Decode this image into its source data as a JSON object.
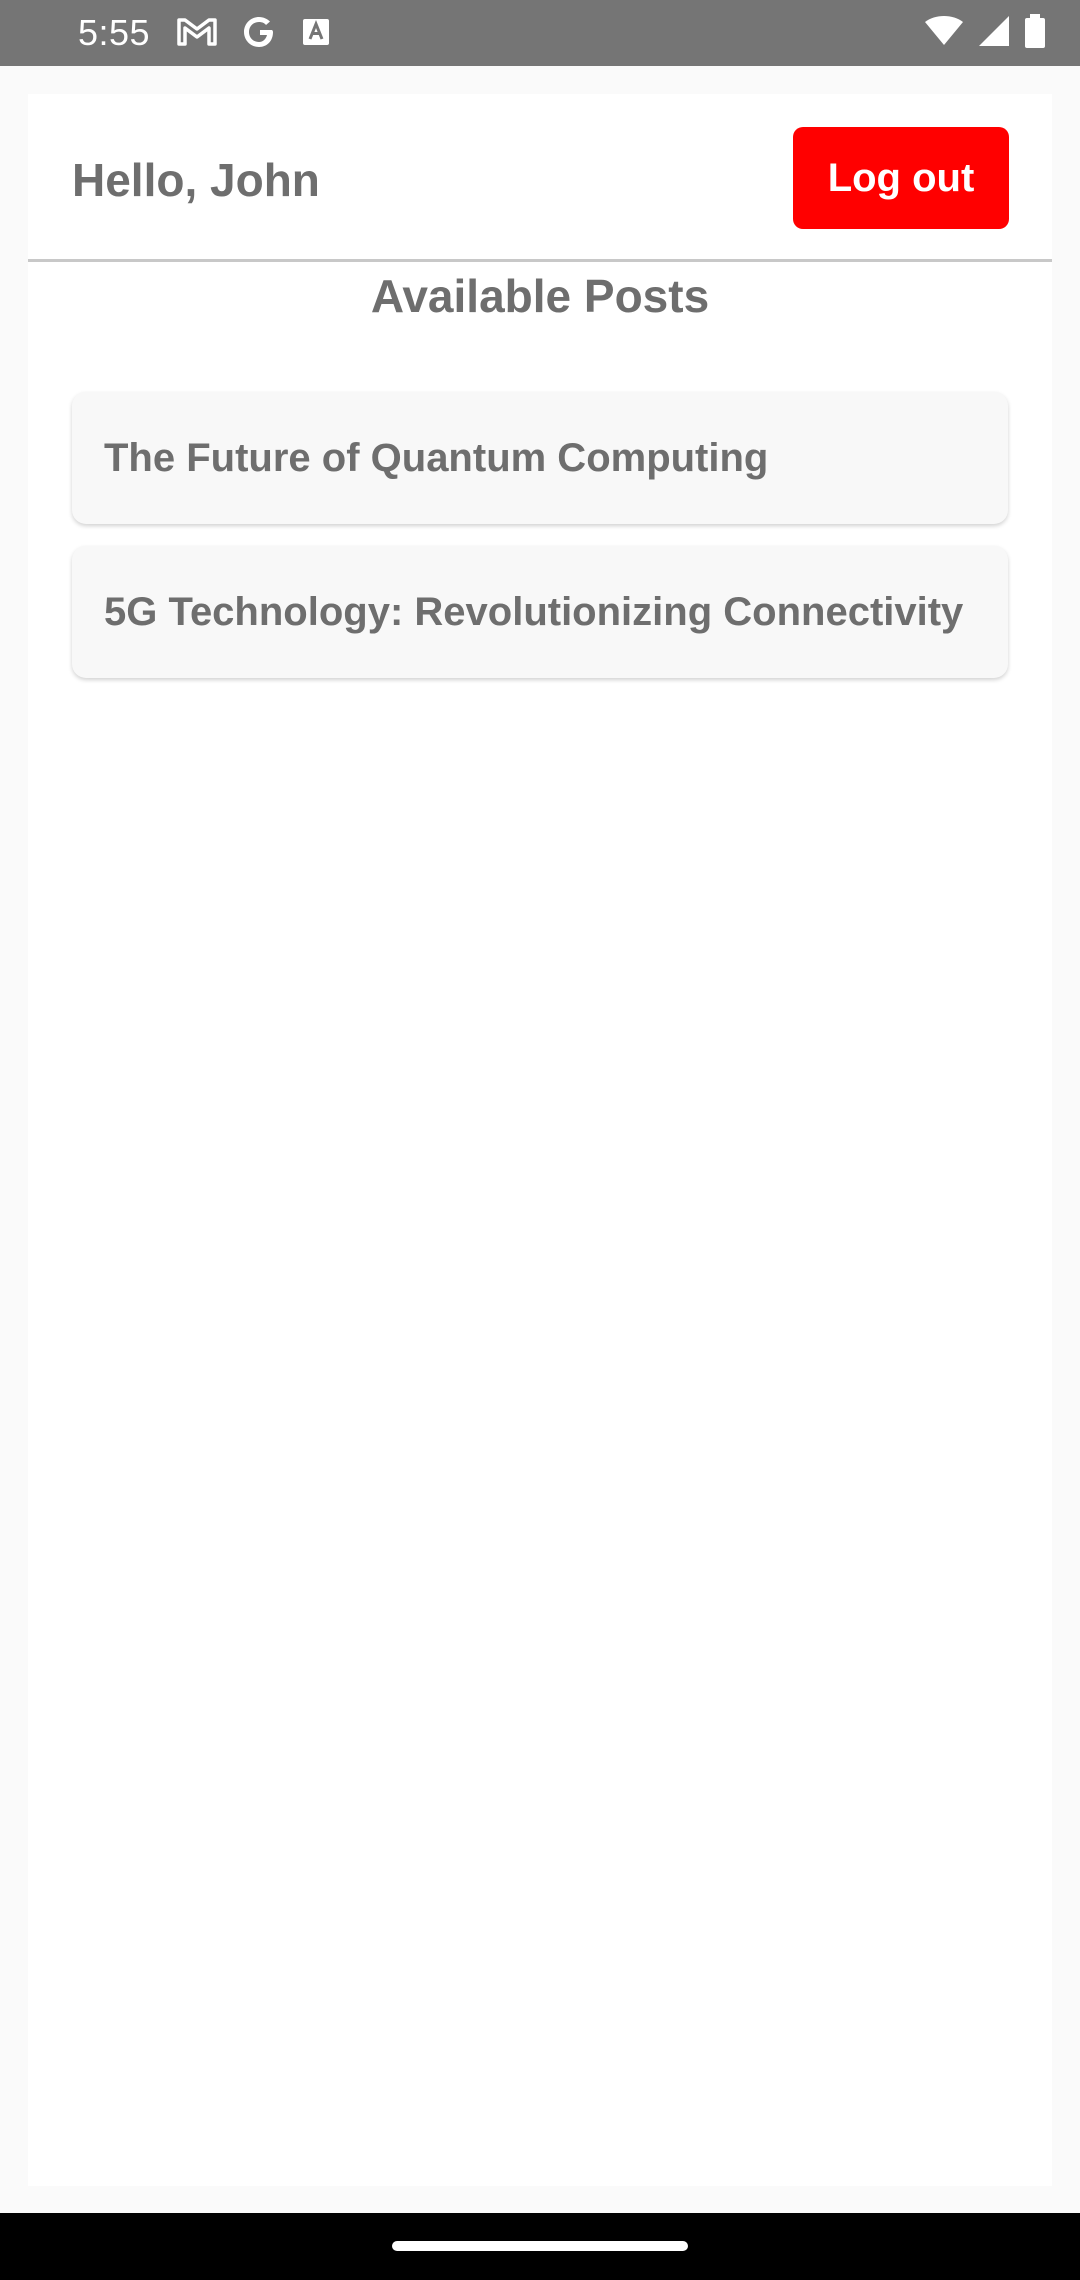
{
  "status_bar": {
    "time": "5:55",
    "left_icons": [
      "gmail-icon",
      "google-icon",
      "font-a-icon"
    ],
    "right_icons": [
      "wifi-icon",
      "signal-icon",
      "battery-icon"
    ]
  },
  "header": {
    "greeting": "Hello, John",
    "logout_label": "Log out"
  },
  "colors": {
    "logout_button": "#ff0000",
    "text": "#6e6e6e",
    "status_bar": "#757575"
  },
  "main": {
    "section_title": "Available Posts",
    "posts": [
      {
        "title": "The Future of Quantum Computing"
      },
      {
        "title": "5G Technology: Revolutionizing Connectivity"
      }
    ]
  }
}
